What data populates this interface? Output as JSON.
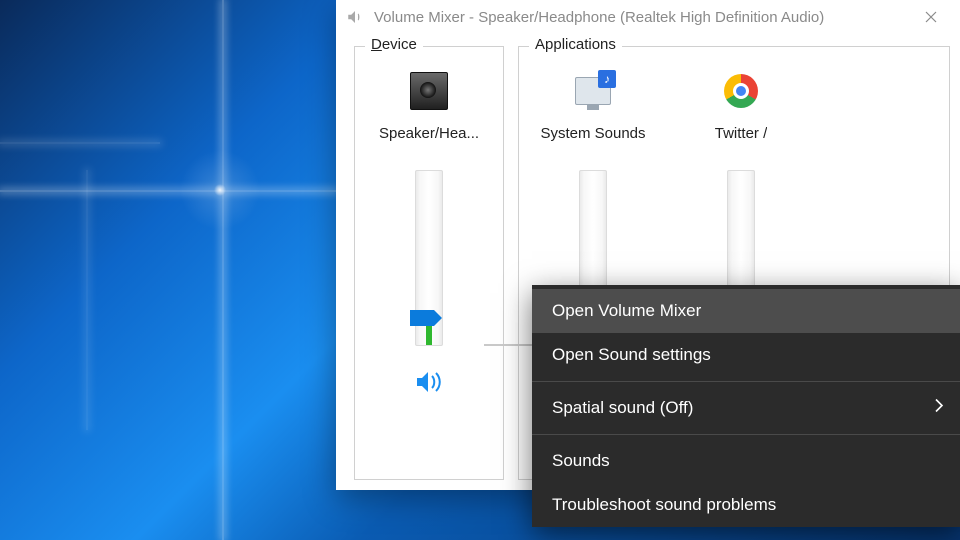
{
  "window": {
    "title": "Volume Mixer - Speaker/Headphone (Realtek High Definition Audio)"
  },
  "groups": {
    "device_label_pre": "D",
    "device_label_rest": "evice",
    "apps_label": "Applications"
  },
  "channels": [
    {
      "name": "Speaker/Hea...",
      "level_percent": 12,
      "has_meter": true,
      "icon": "speaker-box"
    },
    {
      "name": "System Sounds",
      "level_percent": 12,
      "has_meter": false,
      "icon": "monitor-note"
    },
    {
      "name": "Twitter /",
      "level_percent": 12,
      "has_meter": false,
      "icon": "chrome"
    }
  ],
  "context_menu": {
    "items": [
      {
        "label": "Open Volume Mixer",
        "highlighted": true,
        "has_submenu": false
      },
      {
        "label": "Open Sound settings",
        "highlighted": false,
        "has_submenu": false
      },
      {
        "separator": true
      },
      {
        "label": "Spatial sound (Off)",
        "highlighted": false,
        "has_submenu": true
      },
      {
        "separator": true
      },
      {
        "label": "Sounds",
        "highlighted": false,
        "has_submenu": false
      },
      {
        "label": "Troubleshoot sound problems",
        "highlighted": false,
        "has_submenu": false
      }
    ]
  }
}
